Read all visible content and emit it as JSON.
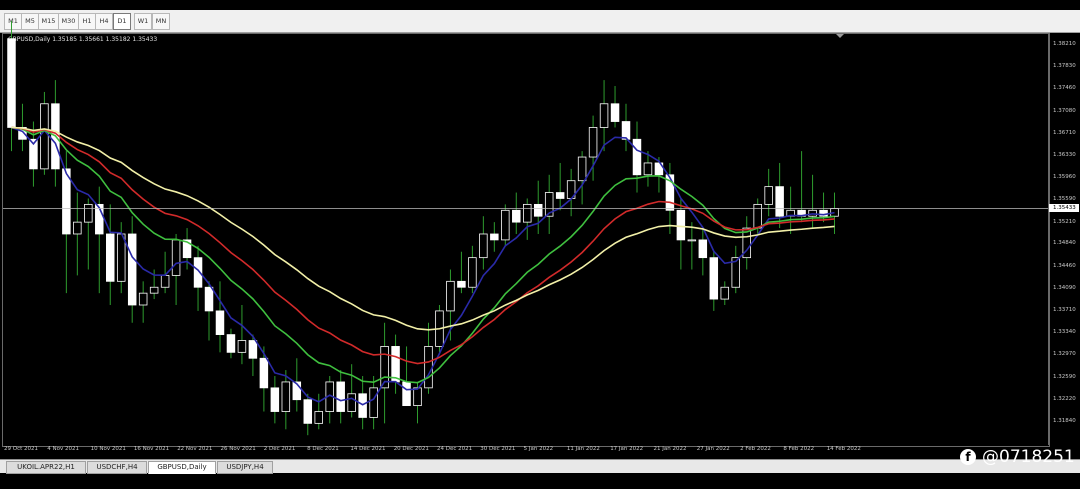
{
  "toolbar": {
    "timeframes": [
      "M1",
      "M5",
      "M15",
      "M30",
      "H1",
      "H4",
      "D1",
      "W1",
      "MN"
    ],
    "active": "D1"
  },
  "chart": {
    "symbol_info": "GBPUSD,Daily  1.35185 1.35661 1.35182 1.35433",
    "current_price": "1.35433"
  },
  "colors": {
    "background": "#000000",
    "bull": "#ffffff",
    "bear": "#ffffff",
    "wick": "#2e9c2e",
    "ma_fast": "#2a2aa8",
    "ma_green": "#3fbf3f",
    "ma_red": "#d12a2a",
    "ma_yellow": "#f2f0a8"
  },
  "chart_data": {
    "type": "candlestick",
    "y_ticks": [
      "1.38210",
      "1.37830",
      "1.37460",
      "1.37080",
      "1.36710",
      "1.36330",
      "1.35960",
      "1.35590",
      "1.35210",
      "1.34840",
      "1.34460",
      "1.34090",
      "1.33710",
      "1.33340",
      "1.32970",
      "1.32590",
      "1.32220",
      "1.31840"
    ],
    "x_ticks": [
      "29 Oct 2021",
      "4 Nov 2021",
      "10 Nov 2021",
      "16 Nov 2021",
      "22 Nov 2021",
      "26 Nov 2021",
      "2 Dec 2021",
      "8 Dec 2021",
      "14 Dec 2021",
      "20 Dec 2021",
      "24 Dec 2021",
      "30 Dec 2021",
      "5 Jan 2022",
      "11 Jan 2022",
      "17 Jan 2022",
      "21 Jan 2022",
      "27 Jan 2022",
      "2 Feb 2022",
      "8 Feb 2022",
      "14 Feb 2022"
    ],
    "ylim": [
      1.3165,
      1.384
    ],
    "series": [
      {
        "name": "",
        "values": []
      }
    ],
    "candles": [
      [
        1.383,
        1.386,
        1.364,
        1.368
      ],
      [
        1.368,
        1.372,
        1.364,
        1.366
      ],
      [
        1.366,
        1.369,
        1.358,
        1.361
      ],
      [
        1.361,
        1.374,
        1.36,
        1.372
      ],
      [
        1.372,
        1.376,
        1.358,
        1.361
      ],
      [
        1.361,
        1.364,
        1.34,
        1.35
      ],
      [
        1.35,
        1.357,
        1.343,
        1.352
      ],
      [
        1.352,
        1.356,
        1.344,
        1.355
      ],
      [
        1.355,
        1.358,
        1.34,
        1.35
      ],
      [
        1.35,
        1.355,
        1.338,
        1.342
      ],
      [
        1.342,
        1.352,
        1.34,
        1.35
      ],
      [
        1.35,
        1.353,
        1.335,
        1.338
      ],
      [
        1.338,
        1.342,
        1.335,
        1.34
      ],
      [
        1.34,
        1.344,
        1.339,
        1.341
      ],
      [
        1.341,
        1.347,
        1.34,
        1.343
      ],
      [
        1.343,
        1.35,
        1.338,
        1.349
      ],
      [
        1.349,
        1.351,
        1.344,
        1.346
      ],
      [
        1.346,
        1.348,
        1.337,
        1.341
      ],
      [
        1.341,
        1.342,
        1.332,
        1.337
      ],
      [
        1.337,
        1.342,
        1.33,
        1.333
      ],
      [
        1.333,
        1.334,
        1.329,
        1.33
      ],
      [
        1.33,
        1.338,
        1.328,
        1.332
      ],
      [
        1.332,
        1.333,
        1.326,
        1.329
      ],
      [
        1.329,
        1.331,
        1.32,
        1.324
      ],
      [
        1.324,
        1.326,
        1.318,
        1.32
      ],
      [
        1.32,
        1.327,
        1.317,
        1.325
      ],
      [
        1.325,
        1.329,
        1.32,
        1.322
      ],
      [
        1.322,
        1.323,
        1.316,
        1.318
      ],
      [
        1.318,
        1.323,
        1.317,
        1.32
      ],
      [
        1.32,
        1.326,
        1.318,
        1.325
      ],
      [
        1.325,
        1.327,
        1.318,
        1.32
      ],
      [
        1.32,
        1.328,
        1.319,
        1.323
      ],
      [
        1.323,
        1.326,
        1.317,
        1.319
      ],
      [
        1.319,
        1.326,
        1.317,
        1.324
      ],
      [
        1.324,
        1.335,
        1.318,
        1.331
      ],
      [
        1.331,
        1.333,
        1.323,
        1.325
      ],
      [
        1.325,
        1.331,
        1.321,
        1.321
      ],
      [
        1.321,
        1.325,
        1.318,
        1.324
      ],
      [
        1.324,
        1.335,
        1.323,
        1.331
      ],
      [
        1.331,
        1.338,
        1.33,
        1.337
      ],
      [
        1.337,
        1.344,
        1.332,
        1.342
      ],
      [
        1.342,
        1.347,
        1.34,
        1.341
      ],
      [
        1.341,
        1.348,
        1.34,
        1.346
      ],
      [
        1.346,
        1.353,
        1.344,
        1.35
      ],
      [
        1.35,
        1.352,
        1.347,
        1.349
      ],
      [
        1.349,
        1.355,
        1.348,
        1.354
      ],
      [
        1.354,
        1.357,
        1.35,
        1.352
      ],
      [
        1.352,
        1.356,
        1.349,
        1.355
      ],
      [
        1.355,
        1.359,
        1.35,
        1.353
      ],
      [
        1.353,
        1.36,
        1.35,
        1.357
      ],
      [
        1.357,
        1.362,
        1.354,
        1.356
      ],
      [
        1.356,
        1.361,
        1.353,
        1.359
      ],
      [
        1.359,
        1.364,
        1.355,
        1.363
      ],
      [
        1.363,
        1.37,
        1.359,
        1.368
      ],
      [
        1.368,
        1.376,
        1.364,
        1.372
      ],
      [
        1.372,
        1.375,
        1.368,
        1.369
      ],
      [
        1.369,
        1.372,
        1.364,
        1.366
      ],
      [
        1.366,
        1.369,
        1.357,
        1.36
      ],
      [
        1.36,
        1.364,
        1.358,
        1.362
      ],
      [
        1.362,
        1.363,
        1.357,
        1.36
      ],
      [
        1.36,
        1.362,
        1.35,
        1.354
      ],
      [
        1.354,
        1.356,
        1.344,
        1.349
      ],
      [
        1.349,
        1.352,
        1.344,
        1.349
      ],
      [
        1.349,
        1.351,
        1.343,
        1.346
      ],
      [
        1.346,
        1.347,
        1.337,
        1.339
      ],
      [
        1.339,
        1.342,
        1.338,
        1.341
      ],
      [
        1.341,
        1.348,
        1.34,
        1.346
      ],
      [
        1.346,
        1.353,
        1.344,
        1.351
      ],
      [
        1.351,
        1.356,
        1.35,
        1.355
      ],
      [
        1.355,
        1.361,
        1.353,
        1.358
      ],
      [
        1.358,
        1.362,
        1.351,
        1.353
      ],
      [
        1.353,
        1.358,
        1.35,
        1.354
      ],
      [
        1.354,
        1.364,
        1.352,
        1.353
      ],
      [
        1.353,
        1.36,
        1.351,
        1.354
      ],
      [
        1.354,
        1.357,
        1.352,
        1.353
      ],
      [
        1.353,
        1.357,
        1.35,
        1.3543
      ]
    ],
    "xlabel": "",
    "ylabel": ""
  },
  "tabs": [
    "UKOIL.APR22,H1",
    "USDCHF,H4",
    "GBPUSD,Daily",
    "USDJPY,H4"
  ],
  "active_tab": "GBPUSD,Daily",
  "watermark": "@0718251",
  "watermark_icon": "facebook-icon"
}
